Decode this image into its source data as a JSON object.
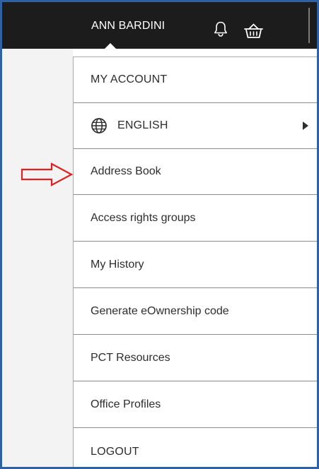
{
  "header": {
    "user_name": "ANN BARDINI",
    "icons": [
      "bell-icon",
      "basket-icon"
    ]
  },
  "menu": {
    "items": [
      {
        "label": "MY ACCOUNT"
      },
      {
        "label": "ENGLISH",
        "icon": "globe-icon",
        "submenu_indicator": "chevron-right-icon"
      },
      {
        "label": "Address Book"
      },
      {
        "label": "Access rights groups"
      },
      {
        "label": "My History"
      },
      {
        "label": "Generate eOwnership code"
      },
      {
        "label": "PCT Resources"
      },
      {
        "label": "Office Profiles"
      },
      {
        "label": "LOGOUT"
      }
    ]
  },
  "annotation": {
    "icon": "red-arrow-icon",
    "color": "#e02020"
  },
  "colors": {
    "topbar": "#1c1c1c",
    "frame_border": "#2f62a5",
    "menu_text": "#2d2d2d",
    "divider": "#8d8d8d"
  }
}
